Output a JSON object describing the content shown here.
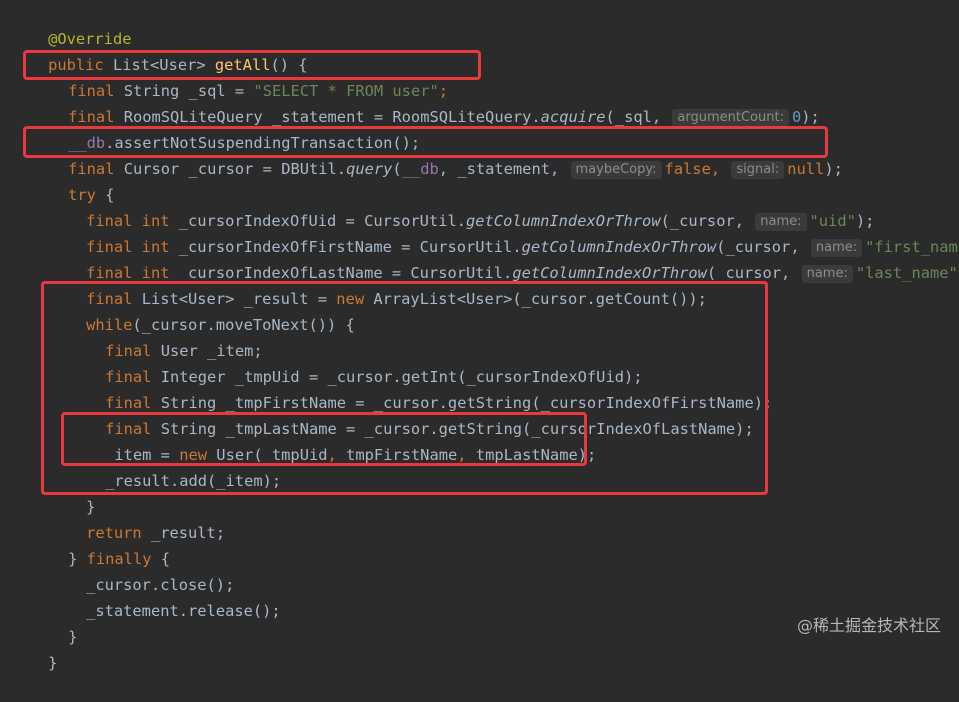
{
  "code": {
    "l1": {
      "annotation": "@Override"
    },
    "l2": {
      "kw_public": "public ",
      "type": "List<User> ",
      "method": "getAll",
      "tail": "() {"
    },
    "l3": {
      "kw": "final ",
      "type": "String _sql = ",
      "str": "\"SELECT * FROM user\"",
      "semi": ";"
    },
    "l4": {
      "kw": "final ",
      "pre": "RoomSQLiteQuery _statement = RoomSQLiteQuery.",
      "call": "acquire",
      "args": "(_sql, ",
      "hint": "argumentCount:",
      "num": "0",
      "tail": ");"
    },
    "l5": {
      "field": "__db",
      "tail": ".assertNotSuspendingTransaction();"
    },
    "l6": {
      "kw": "final ",
      "pre": "Cursor _cursor = DBUtil.",
      "call": "query",
      "paren": "(",
      "field": "__db",
      "mid": ", _statement, ",
      "hint1": "maybeCopy:",
      "kw_false": "false",
      "comma": ", ",
      "hint2": "signal:",
      "kw_null": "null",
      "tail": ");"
    },
    "l7": {
      "kw_try": "try",
      "tail": " {"
    },
    "l8": {
      "kw": "final int ",
      "pre": "_cursorIndexOfUid = CursorUtil.",
      "call": "getColumnIndexOrThrow",
      "args": "(_cursor, ",
      "hint": "name:",
      "str": "\"uid\"",
      "tail": ");"
    },
    "l9": {
      "kw": "final int ",
      "pre": "_cursorIndexOfFirstName = CursorUtil.",
      "call": "getColumnIndexOrThrow",
      "args": "(_cursor, ",
      "hint": "name:",
      "str": "\"first_name\"",
      "tail": ")"
    },
    "l10": {
      "kw": "final int ",
      "pre": "_cursorIndexOfLastName = CursorUtil.",
      "call": "getColumnIndexOrThrow",
      "args": "(_cursor, ",
      "hint": "name:",
      "str": "\"last_name\"",
      "tail": ");"
    },
    "l11": {
      "kw": "final ",
      "pre": "List<User> _result = ",
      "kw_new": "new ",
      "tail": "ArrayList<User>(_cursor.getCount());"
    },
    "l12": {
      "kw_while": "while",
      "tail": "(_cursor.moveToNext()) {"
    },
    "l13": {
      "kw": "final ",
      "tail": "User _item;"
    },
    "l14": {
      "kw": "final ",
      "tail": "Integer _tmpUid = _cursor.getInt(_cursorIndexOfUid);"
    },
    "l15": {
      "kw": "final ",
      "tail": "String _tmpFirstName = _cursor.getString(_cursorIndexOfFirstName);"
    },
    "l16": {
      "kw": "final ",
      "tail": "String _tmpLastName = _cursor.getString(_cursorIndexOfLastName);"
    },
    "l17": {
      "pre": "_item = ",
      "kw_new": "new ",
      "a": "User(_tmpUid",
      "c1": ",",
      "b": "_tmpFirstName",
      "c2": ",",
      "c": "_tmpLastName);"
    },
    "l18": {
      "text": "_result.add(_item);"
    },
    "l19": {
      "text": "}"
    },
    "l20": {
      "kw_return": "return ",
      "tail": "_result;"
    },
    "l21": {
      "pre": "} ",
      "kw_finally": "finally",
      "tail": " {"
    },
    "l22": {
      "text": "_cursor.close();"
    },
    "l23": {
      "text": "_statement.release();"
    },
    "l24": {
      "text": "}"
    },
    "l25": {
      "text": "}"
    }
  },
  "watermark": "@稀土掘金技术社区",
  "colors": {
    "highlight_border": "#e8393f",
    "background": "#2b2b2b",
    "keyword": "#cc7832",
    "string": "#6a8759",
    "method": "#ffc66d",
    "field": "#9876aa",
    "number": "#6897bb",
    "annotation": "#bbb529"
  }
}
